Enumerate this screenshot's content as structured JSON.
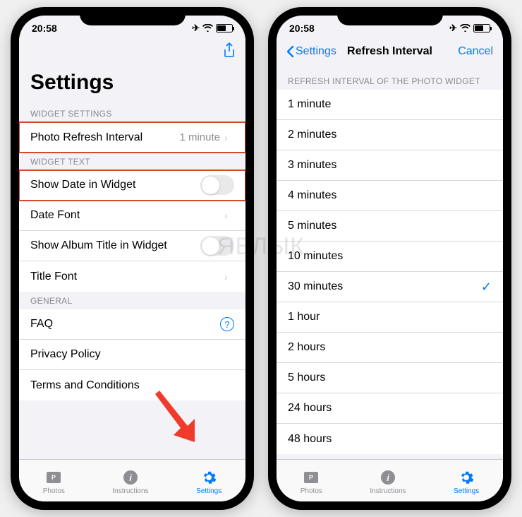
{
  "status": {
    "time": "20:58"
  },
  "watermark": "ЯБЛЫК",
  "left": {
    "title": "Settings",
    "sections": {
      "widget_settings": {
        "header": "WIDGET SETTINGS",
        "refresh_label": "Photo Refresh Interval",
        "refresh_value": "1 minute"
      },
      "widget_text": {
        "header": "WIDGET TEXT",
        "show_date": "Show Date in Widget",
        "date_font": "Date Font",
        "show_album": "Show Album Title in Widget",
        "title_font": "Title Font"
      },
      "general": {
        "header": "GENERAL",
        "faq": "FAQ",
        "privacy": "Privacy Policy",
        "terms": "Terms and Conditions"
      }
    }
  },
  "right": {
    "back": "Settings",
    "title": "Refresh Interval",
    "cancel": "Cancel",
    "section_header": "REFRESH INTERVAL OF THE PHOTO WIDGET",
    "options": [
      "1 minute",
      "2 minutes",
      "3 minutes",
      "4 minutes",
      "5 minutes",
      "10 minutes",
      "30 minutes",
      "1 hour",
      "2 hours",
      "5 hours",
      "24 hours",
      "48 hours"
    ],
    "selected": "30 minutes"
  },
  "tabs": {
    "photos": "Photos",
    "instructions": "Instructions",
    "settings": "Settings"
  }
}
